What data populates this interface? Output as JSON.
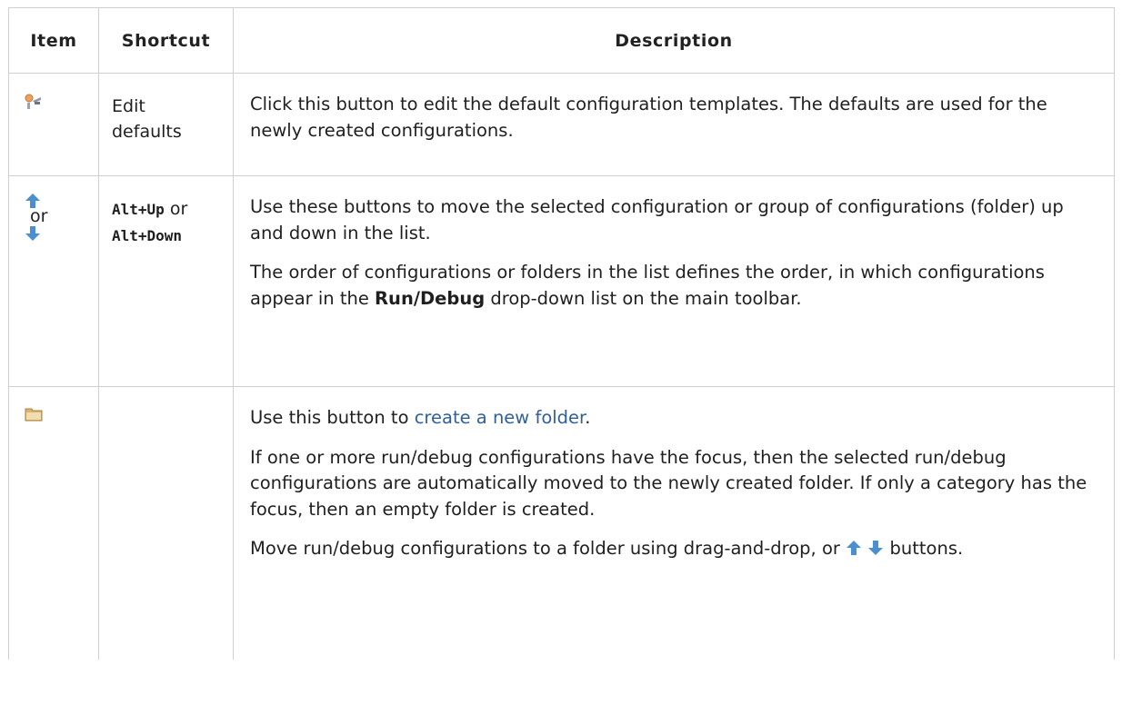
{
  "headers": {
    "item": "Item",
    "shortcut": "Shortcut",
    "description": "Description"
  },
  "rows": [
    {
      "icon": "edit-defaults-icon",
      "shortcut": "Edit defaults",
      "paragraphs": [
        "Click this button to edit the default configuration templates. The defaults are used for the newly created configurations."
      ]
    },
    {
      "icon": "arrow-up-down-icons",
      "or_label": "or",
      "shortcut_a": "Alt+Up",
      "shortcut_or": "or",
      "shortcut_b": "Alt+Down",
      "p1": "Use these buttons to move the selected configuration or group of configurations (folder) up and down in the list.",
      "p2_before": "The order of configurations or folders in the list defines the order, in which configurations appear in the ",
      "p2_bold": "Run/Debug",
      "p2_after": " drop-down list on the main toolbar."
    },
    {
      "icon": "folder-icon",
      "p1_before": "Use this button to ",
      "p1_link": "create a new folder",
      "p1_after": ".",
      "p2": "If one or more run/debug configurations have the focus, then the selected run/debug configurations are automatically moved to the newly created folder. If only a category has the focus, then an empty folder is created.",
      "p3_before": "Move run/debug configurations to a folder using drag-and-drop, or ",
      "p3_after": "buttons."
    }
  ],
  "colors": {
    "link": "#315f9a",
    "border": "#cfcfcf",
    "arrow": "#4a8fd0",
    "folder": "#c9a55a"
  }
}
